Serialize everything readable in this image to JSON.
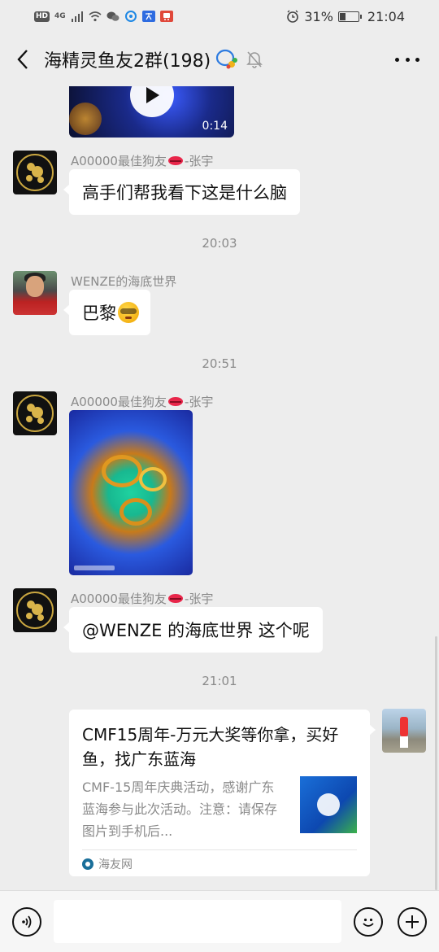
{
  "status_bar": {
    "left_badges": [
      "HD",
      "4G"
    ],
    "left_icons": [
      "signal-icon",
      "wifi-icon",
      "wechat-icon",
      "browser-icon",
      "translate-icon",
      "train-icon"
    ],
    "battery_percent": "31%",
    "battery_level": 0.31,
    "time": "21:04"
  },
  "nav": {
    "title": "海精灵鱼友2群(198)",
    "icons": [
      "back-icon",
      "group-chat-icon",
      "mute-bell-icon",
      "more-icon"
    ]
  },
  "messages": {
    "video": {
      "duration": "0:14"
    },
    "msg1": {
      "sender_prefix": "A00000最佳狗友",
      "sender_suffix": "-张宇",
      "text": "高手们帮我看下这是什么脑"
    },
    "time1": "20:03",
    "msg2": {
      "sender": "WENZE的海底世界",
      "text": "巴黎"
    },
    "time2": "20:51",
    "msg3": {
      "sender_prefix": "A00000最佳狗友",
      "sender_suffix": "-张宇"
    },
    "msg4": {
      "sender_prefix": "A00000最佳狗友",
      "sender_suffix": "-张宇",
      "text": "@WENZE 的海底世界  这个呢"
    },
    "time3": "21:01",
    "card": {
      "title": "CMF15周年-万元大奖等你拿，买好鱼，找广东蓝海",
      "description": "CMF-15周年庆典活动，感谢广东蓝海参与此次活动。注意：请保存图片到手机后...",
      "source": "海友网"
    }
  },
  "input": {
    "value": "",
    "icons": [
      "voice-icon",
      "emoji-icon",
      "plus-icon"
    ]
  },
  "colors": {
    "background": "#ededed",
    "bubble": "#ffffff",
    "meta_text": "#8a8a8a"
  }
}
